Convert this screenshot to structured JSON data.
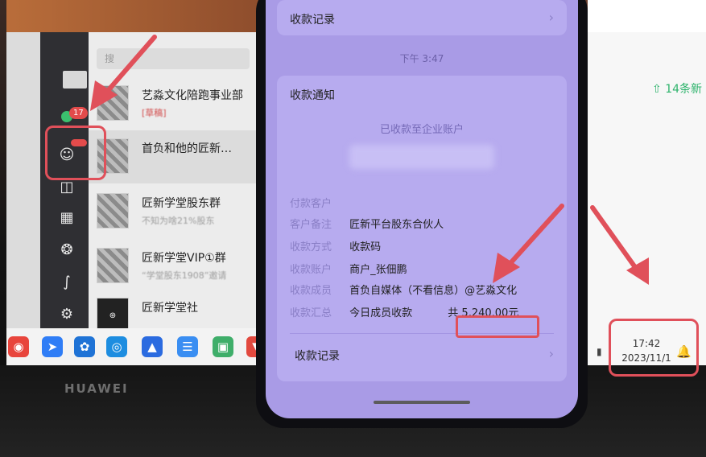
{
  "laptop": {
    "brand": "HUAWEI",
    "search_placeholder": "搜",
    "rail_badge": "17",
    "chats": [
      {
        "title": "艺淼文化陪跑事业部",
        "subtitle_draft": "[草稿]",
        "subtitle": ""
      },
      {
        "title": "首负和他的匠新…",
        "subtitle_draft": "",
        "subtitle": ""
      },
      {
        "title": "匠新学堂股东群",
        "subtitle_draft": "",
        "subtitle": "不知为啥21%股东"
      },
      {
        "title": "匠新学堂VIP①群",
        "subtitle_draft": "",
        "subtitle": "“学堂股东1908”邀请"
      },
      {
        "title": "匠新学堂社",
        "subtitle_draft": "",
        "subtitle": ""
      }
    ],
    "right_pane_count": "14条新",
    "clock_time": "17:42",
    "clock_date": "2023/11/1"
  },
  "phone": {
    "top_card_label": "收款记录",
    "time": "下午 3:47",
    "notice_title": "收款通知",
    "notice_subtitle": "已收款至企业账户",
    "rows": [
      {
        "key": "付款客户",
        "value": ""
      },
      {
        "key": "客户备注",
        "value": "匠新平台股东合伙人"
      },
      {
        "key": "收款方式",
        "value": "收款码"
      },
      {
        "key": "收款账户",
        "value": "商户_张佃鹏"
      },
      {
        "key": "收款成员",
        "value": "首负自媒体（不看信息）@艺淼文化"
      },
      {
        "key": "收款汇总",
        "value": "今日成员收款"
      }
    ],
    "total": "共 5,240.00元",
    "bottom_card_label": "收款记录"
  },
  "colors": {
    "phone_bg": "#a99be6",
    "annotation_red": "#e0505a",
    "accent_green": "#2db36b"
  }
}
